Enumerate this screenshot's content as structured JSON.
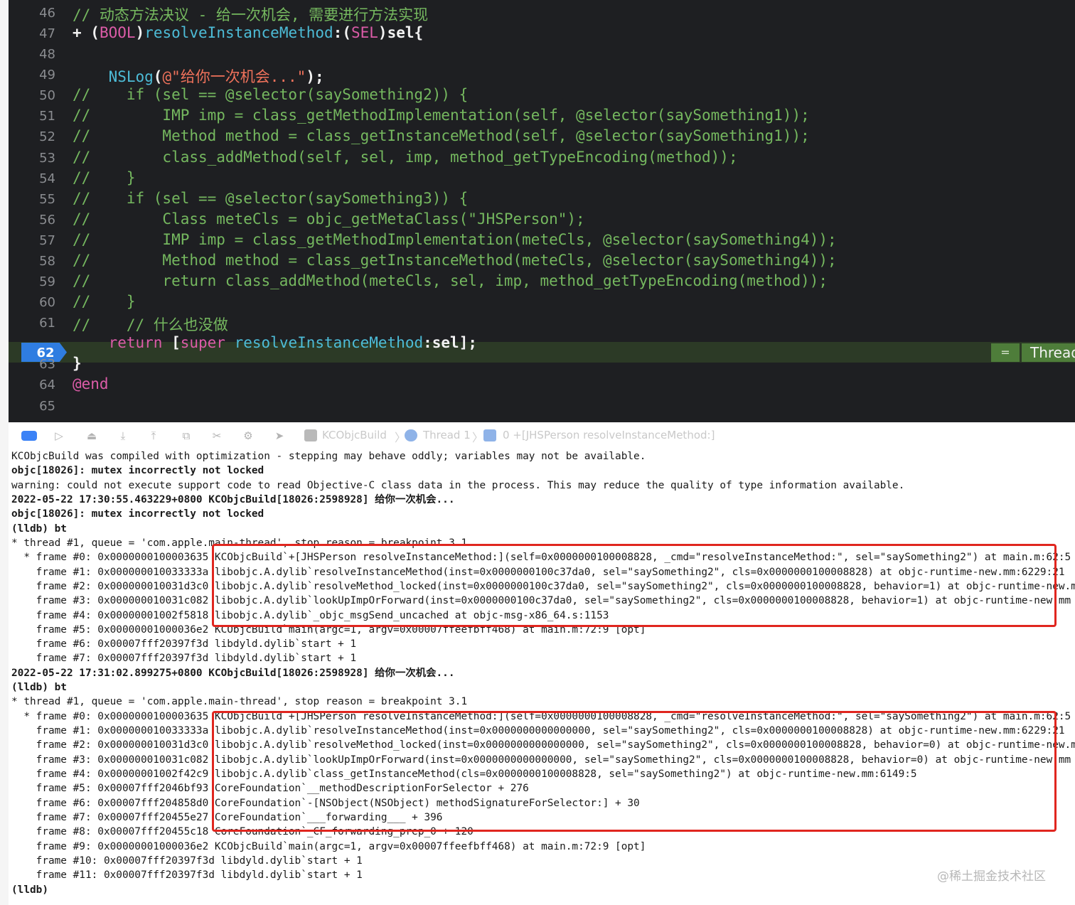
{
  "editor": {
    "lines": [
      {
        "n": "46",
        "parts": [
          {
            "c": "cm",
            "t": "// 动态方法决议 - 给一次机会, 需要进行方法实现"
          }
        ]
      },
      {
        "n": "47",
        "parts": [
          {
            "c": "white",
            "t": "+ ("
          },
          {
            "c": "kw",
            "t": "BOOL"
          },
          {
            "c": "white",
            "t": ")"
          },
          {
            "c": "fn",
            "t": "resolveInstanceMethod"
          },
          {
            "c": "white",
            "t": ":("
          },
          {
            "c": "kw",
            "t": "SEL"
          },
          {
            "c": "white",
            "t": ")sel{"
          }
        ]
      },
      {
        "n": "48",
        "parts": []
      },
      {
        "n": "49",
        "parts": [
          {
            "c": "plain",
            "t": "    "
          },
          {
            "c": "fn",
            "t": "NSLog"
          },
          {
            "c": "white",
            "t": "("
          },
          {
            "c": "str",
            "t": "@\"给你一次机会...\""
          },
          {
            "c": "white",
            "t": ");"
          }
        ]
      },
      {
        "n": "50",
        "parts": [
          {
            "c": "cm",
            "t": "//    if (sel == @selector(saySomething2)) {"
          }
        ]
      },
      {
        "n": "51",
        "parts": [
          {
            "c": "cm",
            "t": "//        IMP imp = class_getMethodImplementation(self, @selector(saySomething1));"
          }
        ]
      },
      {
        "n": "52",
        "parts": [
          {
            "c": "cm",
            "t": "//        Method method = class_getInstanceMethod(self, @selector(saySomething1));"
          }
        ]
      },
      {
        "n": "53",
        "parts": [
          {
            "c": "cm",
            "t": "//        class_addMethod(self, sel, imp, method_getTypeEncoding(method));"
          }
        ]
      },
      {
        "n": "54",
        "parts": [
          {
            "c": "cm",
            "t": "//    }"
          }
        ]
      },
      {
        "n": "55",
        "parts": [
          {
            "c": "cm",
            "t": "//    if (sel == @selector(saySomething3)) {"
          }
        ]
      },
      {
        "n": "56",
        "parts": [
          {
            "c": "cm",
            "t": "//        Class meteCls = objc_getMetaClass(\"JHSPerson\");"
          }
        ]
      },
      {
        "n": "57",
        "parts": [
          {
            "c": "cm",
            "t": "//        IMP imp = class_getMethodImplementation(meteCls, @selector(saySomething4));"
          }
        ]
      },
      {
        "n": "58",
        "parts": [
          {
            "c": "cm",
            "t": "//        Method method = class_getInstanceMethod(meteCls, @selector(saySomething4));"
          }
        ]
      },
      {
        "n": "59",
        "parts": [
          {
            "c": "cm",
            "t": "//        return class_addMethod(meteCls, sel, imp, method_getTypeEncoding(method));"
          }
        ]
      },
      {
        "n": "60",
        "parts": [
          {
            "c": "cm",
            "t": "//    }"
          }
        ]
      },
      {
        "n": "61",
        "parts": [
          {
            "c": "cm",
            "t": "//    // 什么也没做"
          }
        ]
      },
      {
        "n": "62",
        "parts": [
          {
            "c": "plain",
            "t": "    "
          },
          {
            "c": "kw",
            "t": "return"
          },
          {
            "c": "white",
            "t": " ["
          },
          {
            "c": "kw",
            "t": "super"
          },
          {
            "c": "white",
            "t": " "
          },
          {
            "c": "fn",
            "t": "resolveInstanceMethod"
          },
          {
            "c": "white",
            "t": ":sel];"
          }
        ]
      },
      {
        "n": "63",
        "parts": [
          {
            "c": "white",
            "t": "}"
          }
        ]
      },
      {
        "n": "64",
        "parts": [
          {
            "c": "kw",
            "t": "@end"
          }
        ]
      },
      {
        "n": "65",
        "parts": []
      }
    ],
    "breakpoint_line": "62",
    "thread_badge": "Thread",
    "thread_badge_icon": "="
  },
  "debug_bar": {
    "crumb_target": "KCObjcBuild",
    "crumb_thread": "Thread 1",
    "crumb_frame": "0 +[JHSPerson resolveInstanceMethod:]"
  },
  "console": {
    "lines": [
      {
        "b": false,
        "t": "KCObjcBuild was compiled with optimization - stepping may behave oddly; variables may not be available."
      },
      {
        "b": true,
        "t": "objc[18026]: mutex incorrectly not locked"
      },
      {
        "b": false,
        "t": "warning: could not execute support code to read Objective-C class data in the process. This may reduce the quality of type information available."
      },
      {
        "b": true,
        "t": "2022-05-22 17:30:55.463229+0800 KCObjcBuild[18026:2598928] 给你一次机会..."
      },
      {
        "b": true,
        "t": "objc[18026]: mutex incorrectly not locked"
      },
      {
        "b": true,
        "t": "(lldb) bt"
      },
      {
        "b": false,
        "t": "* thread #1, queue = 'com.apple.main-thread', stop reason = breakpoint 3.1"
      },
      {
        "b": false,
        "t": "  * frame #0: 0x0000000100003635 KCObjcBuild`+[JHSPerson resolveInstanceMethod:](self=0x0000000100008828, _cmd=\"resolveInstanceMethod:\", sel=\"saySomething2\") at main.m:62:5"
      },
      {
        "b": false,
        "t": "    frame #1: 0x000000010033333a libobjc.A.dylib`resolveInstanceMethod(inst=0x0000000100c37da0, sel=\"saySomething2\", cls=0x0000000100008828) at objc-runtime-new.mm:6229:21"
      },
      {
        "b": false,
        "t": "    frame #2: 0x000000010031d3c0 libobjc.A.dylib`resolveMethod_locked(inst=0x0000000100c37da0, sel=\"saySomething2\", cls=0x0000000100008828, behavior=1) at objc-runtime-new.mm"
      },
      {
        "b": false,
        "t": "    frame #3: 0x000000010031c082 libobjc.A.dylib`lookUpImpOrForward(inst=0x0000000100c37da0, sel=\"saySomething2\", cls=0x0000000100008828, behavior=1) at objc-runtime-new.mm"
      },
      {
        "b": false,
        "t": "    frame #4: 0x00000001002f5818 libobjc.A.dylib`_objc_msgSend_uncached at objc-msg-x86_64.s:1153"
      },
      {
        "b": false,
        "t": "    frame #5: 0x00000001000036e2 KCObjcBuild`main(argc=1, argv=0x00007ffeefbff468) at main.m:72:9 [opt]"
      },
      {
        "b": false,
        "t": "    frame #6: 0x00007fff20397f3d libdyld.dylib`start + 1"
      },
      {
        "b": false,
        "t": "    frame #7: 0x00007fff20397f3d libdyld.dylib`start + 1"
      },
      {
        "b": true,
        "t": "2022-05-22 17:31:02.899275+0800 KCObjcBuild[18026:2598928] 给你一次机会..."
      },
      {
        "b": true,
        "t": "(lldb) bt"
      },
      {
        "b": false,
        "t": "* thread #1, queue = 'com.apple.main-thread', stop reason = breakpoint 3.1"
      },
      {
        "b": false,
        "t": "  * frame #0: 0x0000000100003635 KCObjcBuild`+[JHSPerson resolveInstanceMethod:](self=0x0000000100008828, _cmd=\"resolveInstanceMethod:\", sel=\"saySomething2\") at main.m:62:5"
      },
      {
        "b": false,
        "t": "    frame #1: 0x000000010033333a libobjc.A.dylib`resolveInstanceMethod(inst=0x0000000000000000, sel=\"saySomething2\", cls=0x0000000100008828) at objc-runtime-new.mm:6229:21"
      },
      {
        "b": false,
        "t": "    frame #2: 0x000000010031d3c0 libobjc.A.dylib`resolveMethod_locked(inst=0x0000000000000000, sel=\"saySomething2\", cls=0x0000000100008828, behavior=0) at objc-runtime-new.mm"
      },
      {
        "b": false,
        "t": "    frame #3: 0x000000010031c082 libobjc.A.dylib`lookUpImpOrForward(inst=0x0000000000000000, sel=\"saySomething2\", cls=0x0000000100008828, behavior=0) at objc-runtime-new.mm"
      },
      {
        "b": false,
        "t": "    frame #4: 0x00000001002f42c9 libobjc.A.dylib`class_getInstanceMethod(cls=0x0000000100008828, sel=\"saySomething2\") at objc-runtime-new.mm:6149:5"
      },
      {
        "b": false,
        "t": "    frame #5: 0x00007fff2046bf93 CoreFoundation`__methodDescriptionForSelector + 276"
      },
      {
        "b": false,
        "t": "    frame #6: 0x00007fff204858d0 CoreFoundation`-[NSObject(NSObject) methodSignatureForSelector:] + 30"
      },
      {
        "b": false,
        "t": "    frame #7: 0x00007fff20455e27 CoreFoundation`___forwarding___ + 396"
      },
      {
        "b": false,
        "t": "    frame #8: 0x00007fff20455c18 CoreFoundation`_CF_forwarding_prep_0 + 120"
      },
      {
        "b": false,
        "t": "    frame #9: 0x00000001000036e2 KCObjcBuild`main(argc=1, argv=0x00007ffeefbff468) at main.m:72:9 [opt]"
      },
      {
        "b": false,
        "t": "    frame #10: 0x00007fff20397f3d libdyld.dylib`start + 1"
      },
      {
        "b": false,
        "t": "    frame #11: 0x00007fff20397f3d libdyld.dylib`start + 1"
      },
      {
        "b": true,
        "t": "(lldb)"
      }
    ]
  },
  "watermark": "@稀土掘金技术社区"
}
